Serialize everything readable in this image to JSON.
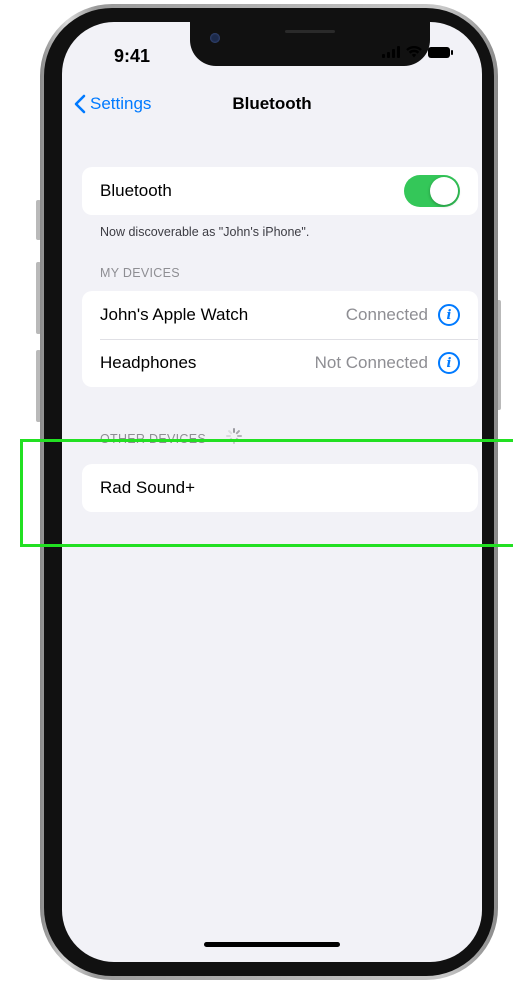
{
  "status_bar": {
    "time": "9:41"
  },
  "nav": {
    "back_label": "Settings",
    "title": "Bluetooth"
  },
  "bluetooth": {
    "label": "Bluetooth",
    "enabled": true,
    "toggle_color": "#34c759",
    "discoverable_text": "Now discoverable as \"John's iPhone\"."
  },
  "my_devices": {
    "header": "MY DEVICES",
    "items": [
      {
        "name": "John's Apple Watch",
        "status": "Connected"
      },
      {
        "name": "Headphones",
        "status": "Not Connected"
      }
    ]
  },
  "other_devices": {
    "header": "OTHER DEVICES",
    "items": [
      {
        "name": "Rad Sound+"
      }
    ]
  },
  "colors": {
    "accent": "#007aff",
    "background": "#f2f2f7",
    "highlight": "#22e022"
  },
  "icons": [
    "chevron-left-icon",
    "signal-icon",
    "wifi-icon",
    "battery-icon",
    "info-icon",
    "spinner-icon"
  ]
}
